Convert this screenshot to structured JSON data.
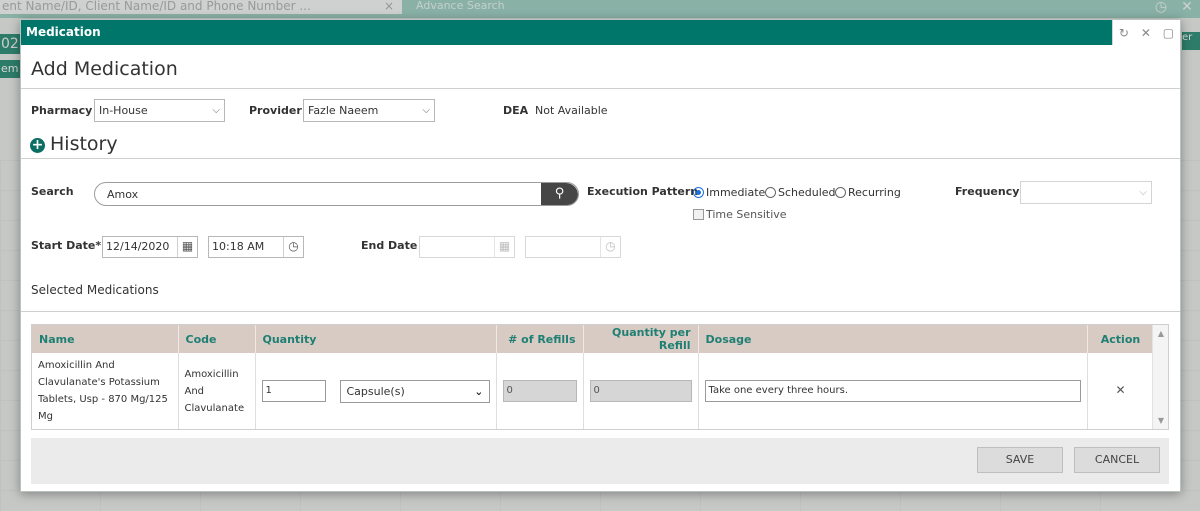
{
  "background": {
    "search_placeholder": "ent Name/ID, Client Name/ID and Phone Number ...",
    "advance_search": "Advance Search",
    "left_num": "02",
    "left_em": "em",
    "right_er": "er"
  },
  "modal": {
    "title": "Medication",
    "heading": "Add Medication",
    "pharmacy": {
      "label": "Pharmacy",
      "value": "In-House"
    },
    "provider": {
      "label": "Provider",
      "value": "Fazle Naeem"
    },
    "dea": {
      "label": "DEA",
      "value": "Not Available"
    },
    "history_label": "History",
    "search": {
      "label": "Search",
      "value": "Amox"
    },
    "execution_pattern": {
      "label": "Execution Pattern",
      "options": [
        "Immediate",
        "Scheduled",
        "Recurring"
      ],
      "selected": "Immediate",
      "time_sensitive": "Time Sensitive"
    },
    "frequency": {
      "label": "Frequency",
      "value": ""
    },
    "start_date": {
      "label": "Start Date*",
      "date": "12/14/2020",
      "time": "10:18 AM"
    },
    "end_date": {
      "label": "End Date",
      "date": "",
      "time": ""
    },
    "selected_medications_label": "Selected Medications",
    "table": {
      "headers": [
        "Name",
        "Code",
        "Quantity",
        "# of Refills",
        "Quantity per Refill",
        "Dosage",
        "Action"
      ],
      "rows": [
        {
          "name": "Amoxicillin And Clavulanate's Potassium Tablets, Usp - 870 Mg/125 Mg",
          "code": "Amoxicillin And Clavulanate",
          "quantity": "1",
          "unit": "Capsule(s)",
          "refills": "0",
          "qty_per_refill": "0",
          "dosage": "Take one every three hours."
        }
      ]
    },
    "buttons": {
      "save": "SAVE",
      "cancel": "CANCEL"
    }
  }
}
